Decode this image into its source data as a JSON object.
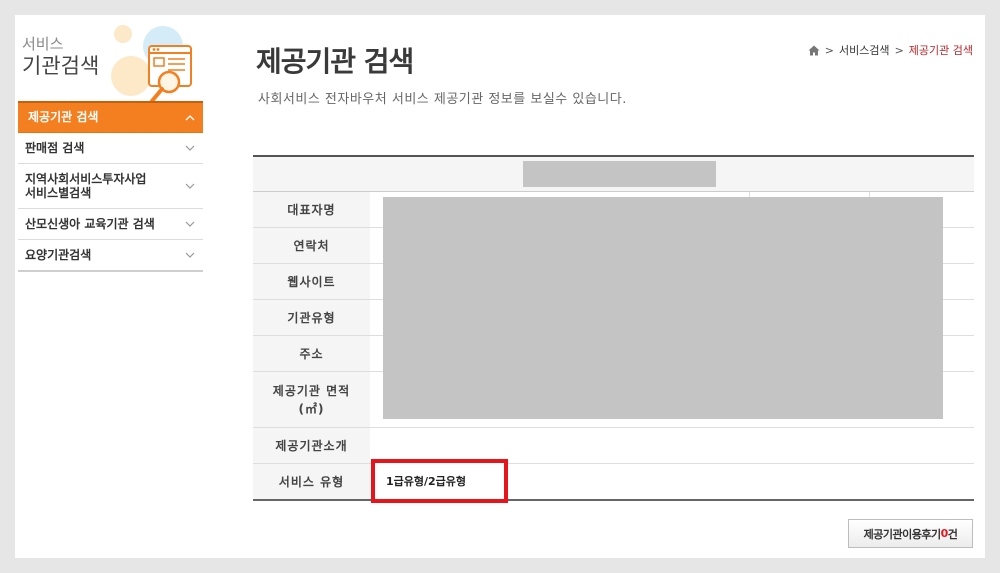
{
  "sidebar": {
    "title_sub": "서비스",
    "title_main": "기관검색",
    "items": [
      {
        "label": "제공기관 검색",
        "active": true
      },
      {
        "label": "판매점 검색"
      },
      {
        "label_line1": "지역사회서비스투자사업",
        "label_line2": "서비스별검색"
      },
      {
        "label": "산모신생아 교육기관 검색"
      },
      {
        "label": "요양기관검색"
      }
    ]
  },
  "header": {
    "title": "제공기관 검색",
    "description": "사회서비스 전자바우처 서비스 제공기관 정보를 보실수 있습니다.",
    "breadcrumb": [
      "서비스검색",
      "제공기관 검색"
    ]
  },
  "table": {
    "rows": [
      {
        "label": "대표자명"
      },
      {
        "label": "연락처"
      },
      {
        "label": "웹사이트"
      },
      {
        "label": "기관유형"
      },
      {
        "label": "주소"
      },
      {
        "label_line1": "제공기관 면적",
        "label_line2": "(㎡)"
      },
      {
        "label": "제공기관소개"
      },
      {
        "label": "서비스 유형",
        "value": "1급유형/2급유형"
      }
    ]
  },
  "review_button": {
    "label": "제공기관이용후기",
    "count": "0",
    "unit": "건"
  },
  "colors": {
    "accent": "#f47f20",
    "highlight": "#e8141b",
    "redacted": "#c4c4c4"
  }
}
